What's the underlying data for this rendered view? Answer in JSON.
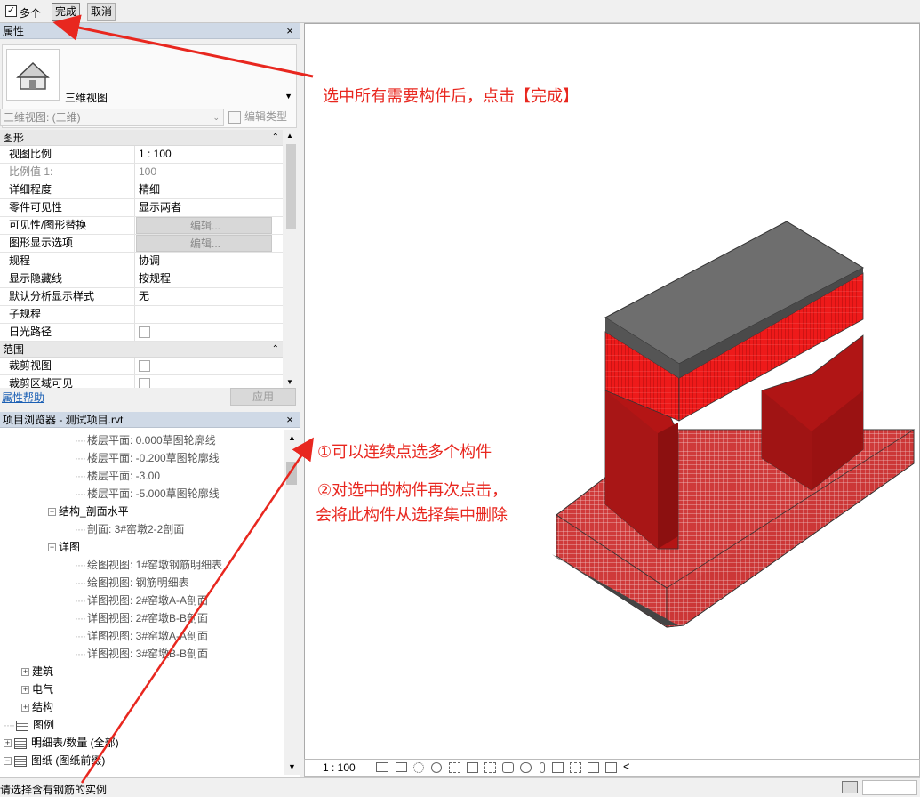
{
  "options_bar": {
    "multiple_checkbox_checked": true,
    "multiple_label": "多个",
    "finish_label": "完成",
    "cancel_label": "取消"
  },
  "properties": {
    "title": "属性",
    "close_glyph": "×",
    "type_name": "三维视图",
    "type_selector": "三维视图: (三维)",
    "edit_type_label": "编辑类型",
    "sections": [
      {
        "title": "图形",
        "rows": [
          {
            "key": "视图比例",
            "value": "1 : 100"
          },
          {
            "key": "比例值 1:",
            "value": "100",
            "disabled": true
          },
          {
            "key": "详细程度",
            "value": "精细"
          },
          {
            "key": "零件可见性",
            "value": "显示两者"
          },
          {
            "key": "可见性/图形替换",
            "value": "编辑...",
            "button": true
          },
          {
            "key": "图形显示选项",
            "value": "编辑...",
            "button": true
          },
          {
            "key": "规程",
            "value": "协调"
          },
          {
            "key": "显示隐藏线",
            "value": "按规程"
          },
          {
            "key": "默认分析显示样式",
            "value": "无"
          },
          {
            "key": "子规程",
            "value": ""
          },
          {
            "key": "日光路径",
            "value": "",
            "checkbox": true
          }
        ]
      },
      {
        "title": "范围",
        "rows": [
          {
            "key": "裁剪视图",
            "value": "",
            "checkbox": true
          },
          {
            "key": "裁剪区域可见",
            "value": "",
            "checkbox": true
          }
        ]
      }
    ],
    "help_link": "属性帮助",
    "apply_label": "应用"
  },
  "project_browser": {
    "title": "项目浏览器 - 测试项目.rvt",
    "close_glyph": "×",
    "nodes": [
      {
        "label": "楼层平面: 0.000草图轮廓线",
        "level": 3
      },
      {
        "label": "楼层平面: -0.200草图轮廓线",
        "level": 3
      },
      {
        "label": "楼层平面: -3.00",
        "level": 3
      },
      {
        "label": "楼层平面: -5.000草图轮廓线",
        "level": 3
      },
      {
        "label": "结构_剖面水平",
        "level": 2,
        "expander": "−"
      },
      {
        "label": "剖面: 3#窑墩2-2剖面",
        "level": 3
      },
      {
        "label": "详图",
        "level": 2,
        "expander": "−"
      },
      {
        "label": "绘图视图: 1#窑墩钢筋明细表",
        "level": 3
      },
      {
        "label": "绘图视图: 钢筋明细表",
        "level": 3
      },
      {
        "label": "详图视图: 2#窑墩A-A剖面",
        "level": 3
      },
      {
        "label": "详图视图: 2#窑墩B-B剖面",
        "level": 3
      },
      {
        "label": "详图视图: 3#窑墩A-A剖面",
        "level": 3
      },
      {
        "label": "详图视图: 3#窑墩B-B剖面",
        "level": 3
      },
      {
        "label": "建筑",
        "level": 1,
        "expander": "+"
      },
      {
        "label": "电气",
        "level": 1,
        "expander": "+"
      },
      {
        "label": "结构",
        "level": 1,
        "expander": "+"
      },
      {
        "label": "图例",
        "level": 0,
        "icon": true
      },
      {
        "label": "明细表/数量 (全部)",
        "level": 0,
        "expander": "+",
        "icon": true
      },
      {
        "label": "图纸 (图纸前缀)",
        "level": 0,
        "expander": "−",
        "icon": true
      }
    ]
  },
  "view": {
    "annotation_top": "选中所有需要构件后，点击【完成】",
    "annotation_1": "①可以连续点选多个构件",
    "annotation_2a": "②对选中的构件再次点击，",
    "annotation_2b": "会将此构件从选择集中删除",
    "scale": "1 : 100",
    "collapse_glyph": "<"
  },
  "status_bar": {
    "message": "请选择含有钢筋的实例"
  },
  "colors": {
    "annotation_red": "#e8271f",
    "selected_red": "#e02020",
    "panel_title": "#cfd9e6",
    "top_grey": "#6e6e6e"
  }
}
